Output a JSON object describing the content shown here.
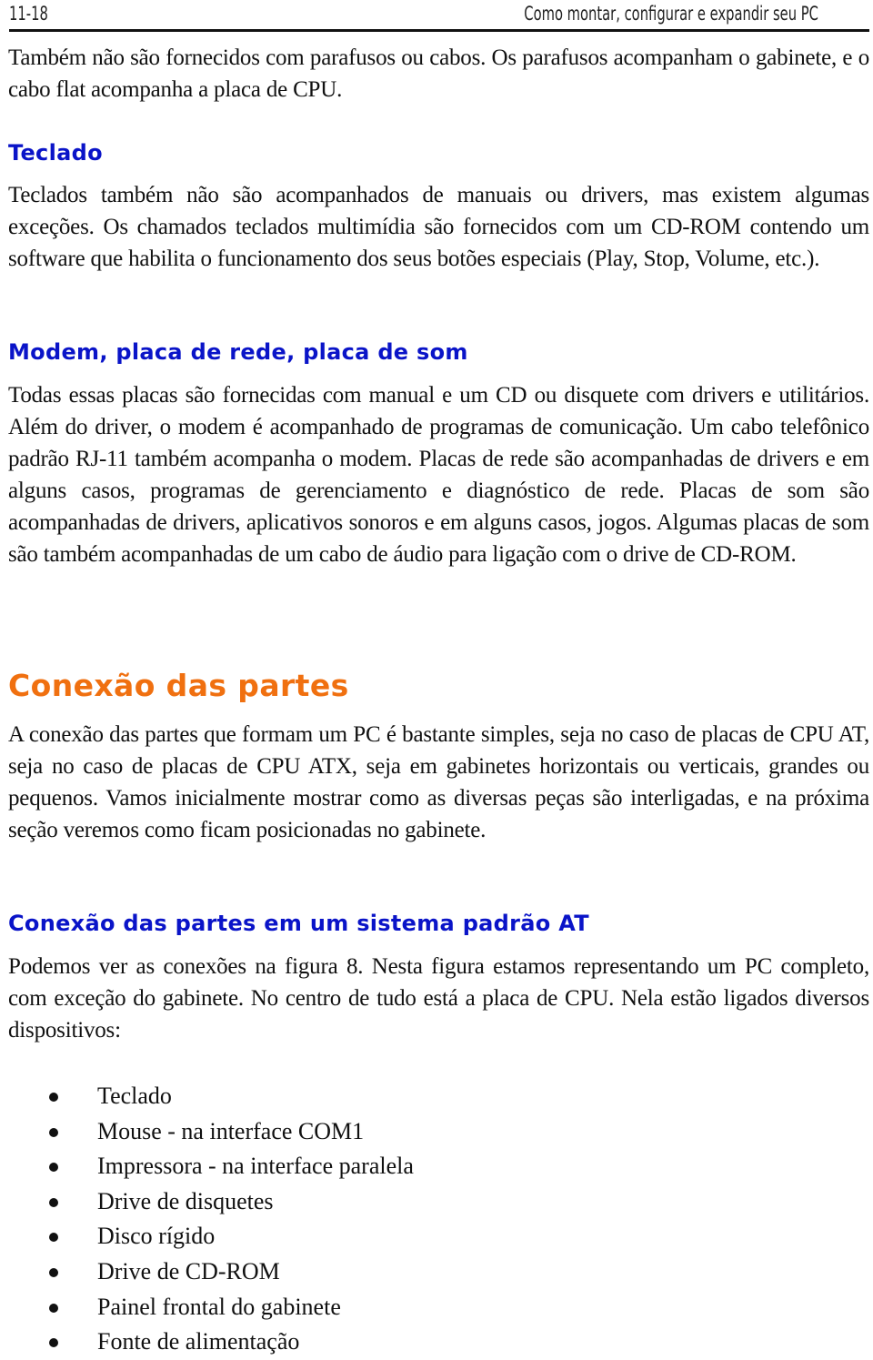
{
  "header": {
    "page_number": "11-18",
    "book_title": "Como montar, configurar e expandir seu PC"
  },
  "colors": {
    "subheading": "#0a14c8",
    "section_heading": "#f07010",
    "text": "#111111"
  },
  "sections": {
    "intro_paragraph": "Também não são fornecidos com parafusos ou cabos. Os parafusos acompanham o gabinete, e o cabo flat acompanha a placa de CPU.",
    "teclado": {
      "heading": "Teclado",
      "paragraph": "Teclados também não são acompanhados de manuais ou drivers, mas existem algumas exceções. Os chamados teclados multimídia são fornecidos com um CD-ROM contendo um software que habilita o funcionamento dos seus botões especiais (Play, Stop, Volume, etc.)."
    },
    "modem": {
      "heading": "Modem, placa de rede, placa de som",
      "paragraph": "Todas essas placas são fornecidas com manual e um CD ou disquete com drivers e utilitários. Além do driver, o modem é acompanhado de programas de comunicação. Um cabo telefônico padrão RJ-11 também acompanha o modem. Placas de rede são acompanhadas de drivers e em alguns casos, programas de gerenciamento e diagnóstico de rede. Placas de som são acompanhadas de drivers, aplicativos sonoros e em alguns casos, jogos. Algumas placas de som são também acompanhadas de um cabo de áudio para ligação com o drive de CD-ROM."
    },
    "conexao": {
      "heading": "Conexão das partes",
      "paragraph": "A conexão das partes que formam um PC é bastante simples, seja no caso de placas de CPU AT, seja no caso de placas de CPU ATX, seja em gabinetes horizontais ou verticais, grandes ou pequenos. Vamos inicialmente mostrar como as diversas peças são interligadas, e na próxima seção veremos como ficam posicionadas no gabinete."
    },
    "conexao_at": {
      "heading": "Conexão das partes em um sistema padrão AT",
      "paragraph": "Podemos ver as conexões na figura 8. Nesta figura estamos representando um PC completo, com exceção do gabinete. No centro de tudo está a placa de CPU. Nela estão ligados diversos dispositivos:",
      "devices": [
        "Teclado",
        "Mouse - na interface COM1",
        "Impressora - na interface paralela",
        "Drive de disquetes",
        "Disco rígido",
        "Drive de CD-ROM",
        "Painel frontal do gabinete",
        "Fonte de alimentação"
      ]
    }
  }
}
